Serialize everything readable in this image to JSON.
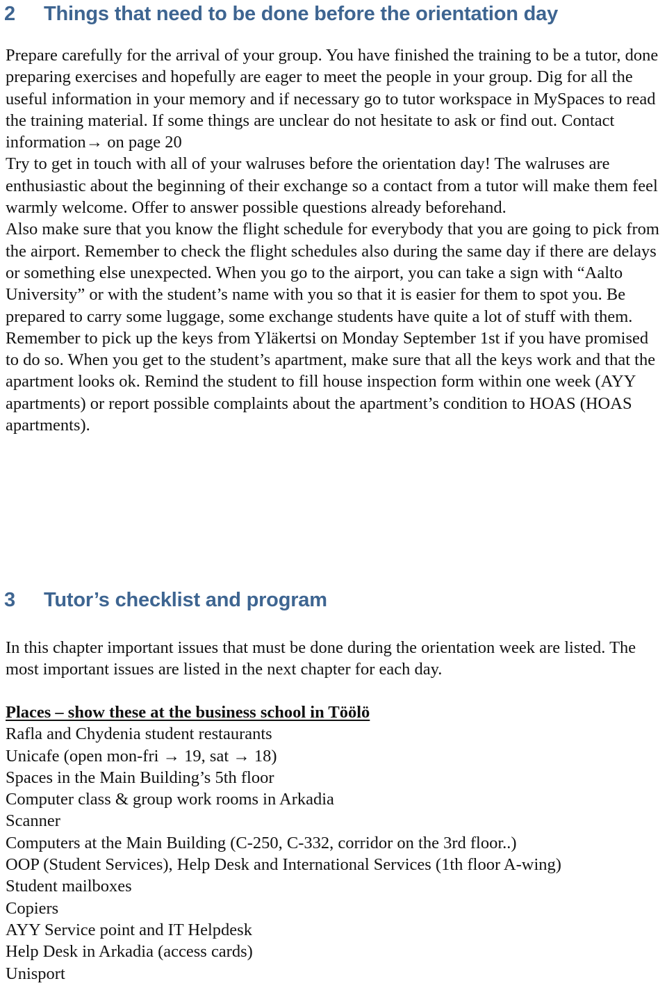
{
  "document": {
    "sections": [
      {
        "number": "2",
        "title": "Things that need to be done before the orientation day"
      },
      {
        "number": "3",
        "title": "Tutor’s checklist and program"
      }
    ]
  },
  "section2": {
    "number": "2",
    "title": "Things that need to be done before the orientation day",
    "paragraphs": [
      "Prepare carefully for the arrival of your group. You have finished the training to be a tutor, done preparing exercises and hopefully are eager to meet the people in your group. Dig for all the useful information in your memory and if necessary go to tutor workspace in MySpaces to read the training material. If some things are unclear do not hesitate to ask or find out. Contact information→ on page 20",
      "Try to get in touch with all of your walruses before the orientation day! The walruses are enthusiastic about the beginning of their exchange so a contact from a tutor will make them feel warmly welcome. Offer to answer possible questions already beforehand.",
      "Also make sure that you know the flight schedule for everybody that you are going to pick from the airport. Remember to check the flight schedules also during the same day if there are delays or something else unexpected. When you go to the airport, you can take a sign with “Aalto University” or with the student’s name with you so that it is easier for them to spot you. Be prepared to carry some luggage, some exchange students have quite a lot of stuff with them.",
      "Remember to pick up the keys from Yläkertsi on Monday September 1st if you have promised to do so. When you get to the student’s apartment, make sure that all the keys work and that the apartment looks ok. Remind the student to fill house inspection form within one week (AYY apartments) or report possible complaints about the apartment’s condition to HOAS (HOAS apartments)."
    ]
  },
  "section3": {
    "number": "3",
    "title": "Tutor’s checklist and program",
    "intro": "In this chapter important issues that must be done during the orientation week are listed. The most important issues are listed in the next chapter for each day.",
    "places": {
      "heading": "Places – show these at the business school in Töölö",
      "items": [
        "Rafla and Chydenia student restaurants",
        "Unicafe (open mon-fri → 19, sat → 18)",
        "Spaces in the Main Building’s 5th floor",
        "Computer class & group work rooms in Arkadia",
        "Scanner",
        "Computers at the Main Building (C-250, C-332, corridor on the 3rd floor..)",
        "OOP (Student Services), Help Desk and International Services (1th floor A-wing)",
        "Student mailboxes",
        "Copiers",
        "AYY Service point and IT Helpdesk",
        "Help Desk in Arkadia (access cards)",
        "Unisport"
      ]
    }
  },
  "theme": {
    "heading_color": "#3e6591",
    "body_color": "#121212",
    "background": "#ffffff"
  }
}
